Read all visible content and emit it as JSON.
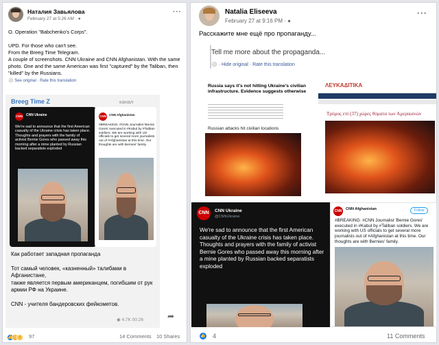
{
  "left_post": {
    "author": "Наталия Завьялова",
    "timestamp": "February 27 at 5:26 AM ·",
    "menu": "···",
    "body": "О. Operation \"Babchenko's Corps\".\n\nUPD. For those who can't see.\nFrom the Breeg Time Telegram.\nA couple of screenshots. CNN Ukraine and CNN Afghanistan. With the same photo. One and the same American was first \"captured\" by the Taliban, then \"killed\" by the Russians.",
    "see_original": "See original · Rate this translation",
    "embed": {
      "channel": "Breeg Time Z",
      "channel_tag": "канал",
      "tweet_left_name": "CNN Ukraine",
      "tweet_left_text": "We're sad to announce that the first American casualty of the Ukraine crisis has taken place. Thoughts and prayers with the family of activist Bernie Gores who passed away this morning after a mine planted by Russian backed separatists exploded",
      "tweet_right_name": "CNN Afghanistan",
      "tweet_right_text": "#BREAKING: #CNN Journalist 'Bernie Gores' executed in #Kabul by #Taliban soldiers. We are working with US officials to get several more journalists out of #Afghanistan at this time. Our thoughts are with Bernies' family.",
      "caption": "Как работает западная пропаганда\n\nТот самый человек, «казненный» талибами в Афганистане,\nтакже является первым американцем, погибшим от рук армии РФ на Украине.\n\nCNN - учителя бандеровских фейкометов.",
      "views": "4.7K",
      "time": "00:26"
    },
    "reaction_count": "97",
    "comments": "14 Comments",
    "shares": "10 Shares"
  },
  "right_post": {
    "author": "Natalia Eliseeva",
    "timestamp": "February 27 at 9:16 PM ·",
    "menu": "···",
    "body_ru": "Расскажите мне ещё про пропаганду...",
    "body_en": "Tell me more about the propaganda...",
    "hide_original": "· Hide original · Rate this translation",
    "article1_headline": "Russia says it's not hitting Ukraine's civilian infrastructure. Evidence suggests otherwise",
    "article1_caption": "Russian attacks hit civilian locations",
    "article2_brand": "ΛΕΥΚΑΔΙΤΙΚΑ",
    "article2_headline": "Τρόμος επί (37) χώρες θύματα των Αμερικανών",
    "cnn_left_name": "CNN Ukraine",
    "cnn_left_handle": "@CNNUkraine",
    "cnn_left_text": "We're sad to announce that the first American casualty of the Ukraine crisis has taken place. Thoughts and prayers with the family of activist Bernie Gores who passed away this morning after a mine planted by Russian backed separatists exploded",
    "cnn_right_name": "CNN Afghanistan",
    "cnn_right_follow": "Follow",
    "cnn_right_text": "#BREAKING: #CNN Journalist 'Bernie Gores' executed in #Kabul by #Taliban soldiers. We are working with US officials to get several more journalists out of #Afghanistan at this time. Our thoughts are with Bernies' family.",
    "reaction_count": "4",
    "comments": "11 Comments"
  },
  "colors": {
    "link": "#385898",
    "meta": "#65676b",
    "telegram_blue": "#3a78c2",
    "cnn_red": "#cc0000",
    "hashtag": "#1d9bf0"
  }
}
